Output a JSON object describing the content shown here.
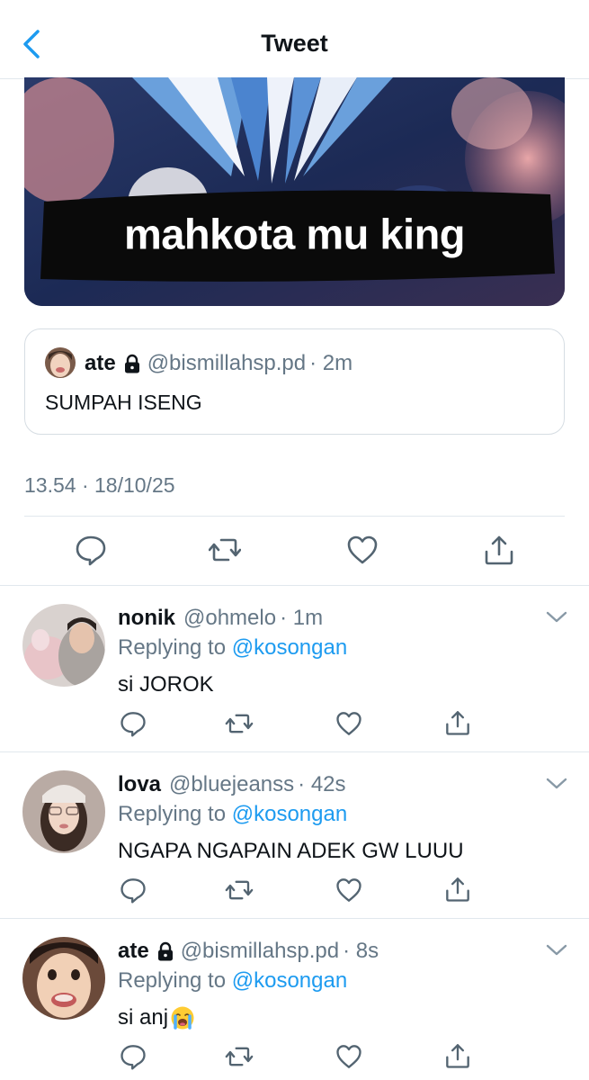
{
  "nav": {
    "title": "Tweet"
  },
  "media": {
    "caption": "mahkota mu king"
  },
  "quoted_tweet": {
    "name": "ate",
    "handle": "@bismillahsp.pd",
    "time": "· 2m",
    "text": "SUMPAH ISENG"
  },
  "tweet": {
    "timestamp": "13.54 · 18/10/25"
  },
  "icons": {
    "back": "chevron-left-icon",
    "reply": "comment-icon",
    "retweet": "retweet-icon",
    "like": "heart-icon",
    "share": "share-icon",
    "more": "chevron-down-icon",
    "lock": "lock-icon"
  },
  "colors": {
    "accent": "#1d9bf0",
    "secondary_text": "#657786",
    "divider": "#e1e8ed"
  },
  "replies": [
    {
      "name": "nonik",
      "handle": "@ohmelo",
      "time": "· 1m",
      "replying_prefix": "Replying to",
      "replying_to": "@kosongan",
      "text": "si JOROK",
      "locked": false
    },
    {
      "name": "lova",
      "handle": "@bluejeanss",
      "time": "· 42s",
      "replying_prefix": "Replying to",
      "replying_to": "@kosongan",
      "text": "NGAPA NGAPAIN ADEK GW LUUU",
      "locked": false
    },
    {
      "name": "ate",
      "handle": "@bismillahsp.pd",
      "time": "· 8s",
      "replying_prefix": "Replying to",
      "replying_to": "@kosongan",
      "text": "si anj",
      "emoji": "loudly-crying-face",
      "locked": true
    }
  ]
}
